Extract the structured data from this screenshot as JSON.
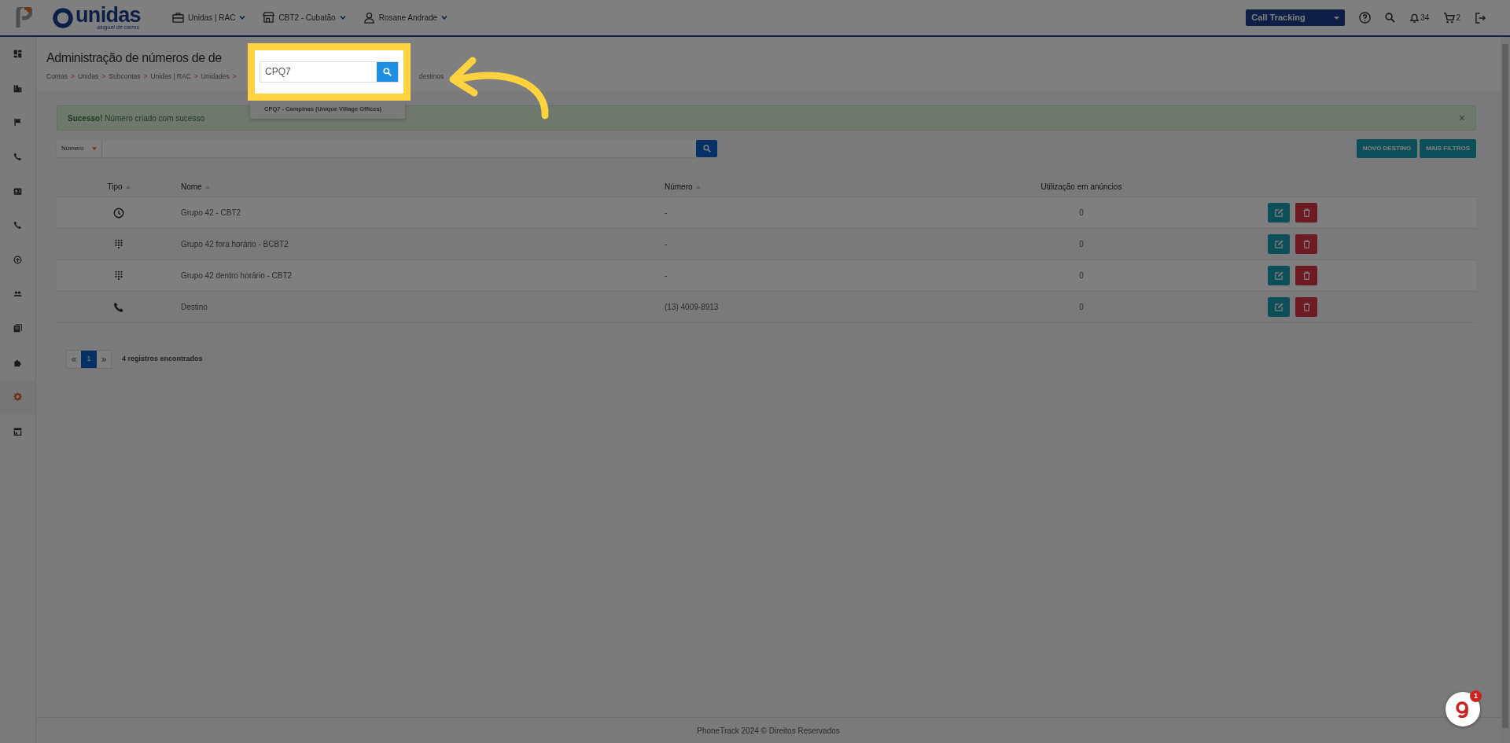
{
  "topbar": {
    "brand": {
      "name": "unidas",
      "tagline": "aluguel de carros"
    },
    "menus": [
      {
        "label": "Unidas | RAC"
      },
      {
        "label": "CBT2 - Cubatão"
      },
      {
        "label": "Rosane Andrade"
      }
    ],
    "product_select": "Call Tracking",
    "notifications": "34",
    "cart": "2"
  },
  "sidebar": {
    "items": [
      {
        "selected": false
      },
      {
        "selected": false
      },
      {
        "selected": false
      },
      {
        "selected": false
      },
      {
        "selected": false
      },
      {
        "selected": false
      },
      {
        "selected": false
      },
      {
        "selected": false
      },
      {
        "selected": false
      },
      {
        "selected": false
      },
      {
        "selected": true
      },
      {
        "selected": false
      }
    ]
  },
  "page": {
    "title": "Administração de números de de",
    "breadcrumb": [
      "Contas",
      "Unidas",
      "Subcontas",
      "Unidas | RAC",
      "Unidades"
    ],
    "breadcrumb_separator": ">",
    "breadcrumb_tail": "destinos"
  },
  "alert": {
    "message": "**Sucesso!** Número criado com sucesso",
    "close": "×"
  },
  "filter": {
    "field_select": "Número"
  },
  "actions": [
    "NOVO DESTINO",
    "MAIS FILTROS"
  ],
  "table": {
    "columns": [
      {
        "label": "Tipo",
        "sortable": true
      },
      {
        "label": "Nome",
        "sortable": true
      },
      {
        "label": "Número",
        "sortable": true
      },
      {
        "label": "Utilização em anúncios",
        "sortable": false
      }
    ],
    "rows": [
      {
        "kind": "schedule",
        "name": "Grupo 42 - CBT2",
        "number": "-",
        "usage": "0"
      },
      {
        "kind": "menu",
        "name": "Grupo 42 fora horário - BCBT2",
        "number": "-",
        "usage": "0"
      },
      {
        "kind": "menu",
        "name": "Grupo 42 dentro horário - CBT2",
        "number": "-",
        "usage": "0"
      },
      {
        "kind": "phone",
        "name": "Destino",
        "number": "(13) 4009-8913",
        "usage": "0"
      }
    ]
  },
  "pagination": {
    "prev": "«",
    "pages": [
      {
        "label": "1",
        "selected": true
      }
    ],
    "next": "»",
    "summary": "4 registros encontrados"
  },
  "footer": "PhoneTrack 2024 © Direitos Reservados",
  "tour": {
    "search_value": "CPQ7",
    "suggestions": [
      "CPQ7 - Campinas (Unique Village Offices)"
    ]
  },
  "chat_widget": {
    "badge": "1"
  }
}
